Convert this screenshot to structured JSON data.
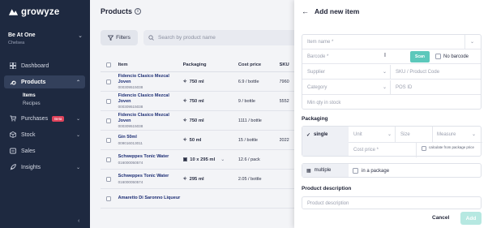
{
  "brand": {
    "name": "growyze"
  },
  "store": {
    "name": "Be At One",
    "subtitle": "Chelsea"
  },
  "nav": {
    "dashboard": "Dashboard",
    "products": "Products",
    "items": "Items",
    "recipes": "Recipes",
    "purchases": "Purchases",
    "purchases_badge": "Beta",
    "stock": "Stock",
    "sales": "Sales",
    "insights": "Insights"
  },
  "main": {
    "title": "Products",
    "filters_label": "Filters",
    "search_placeholder": "Search by product name",
    "columns": {
      "item": "Item",
      "packaging": "Packaging",
      "cost": "Cost price",
      "sku": "SKU"
    },
    "rows": [
      {
        "name": "Fidencio Clasico Mezcal Joven",
        "code": "000309515038",
        "packaging": "750 ml",
        "cost": "6.9 / bottle",
        "sku": "7960",
        "checked": false
      },
      {
        "name": "Fidencio Clasico Mezcal Joven",
        "code": "000309515038",
        "packaging": "750 ml",
        "cost": "9 / bottle",
        "sku": "5552",
        "checked": false
      },
      {
        "name": "Fidencio Clasico Mezcal Joven",
        "code": "000309515038",
        "packaging": "750 ml",
        "cost": "1111 / bottle",
        "sku": "",
        "checked": false
      },
      {
        "name": "Gin 50ml",
        "code": "009016013011",
        "packaging": "50 ml",
        "cost": "15 / bottle",
        "sku": "2022",
        "checked": false
      },
      {
        "name": "Schweppes Tonic Water",
        "code": "016000050574",
        "packaging": "10 x 295 ml",
        "cost": "12.6 / pack",
        "sku": "",
        "checked": true
      },
      {
        "name": "Schweppes Tonic Water",
        "code": "016000050574",
        "packaging": "295 ml",
        "cost": "2.05 / bottle",
        "sku": "",
        "checked": false
      },
      {
        "name": "Amaretto Di Saronno Liqueur",
        "code": "",
        "packaging": "",
        "cost": "",
        "sku": "",
        "checked": false
      }
    ]
  },
  "drawer": {
    "title": "Add new item",
    "item_name_placeholder": "Item name *",
    "barcode_placeholder": "Barcode *",
    "scan_label": "Scan",
    "no_barcode_label": "No barcode",
    "supplier_placeholder": "Supplier",
    "sku_placeholder": "SKU / Product Code",
    "category_placeholder": "Category",
    "pos_placeholder": "POS ID",
    "min_qty_placeholder": "Min qty in stock",
    "packaging_label": "Packaging",
    "single_label": "single",
    "unit_placeholder": "Unit",
    "size_placeholder": "Size",
    "measure_placeholder": "Measure",
    "cost_placeholder": "Cost price *",
    "calculate_label": "calculate from package price",
    "multiple_label": "multiple",
    "in_package_label": "in a package",
    "description_label": "Product description",
    "description_placeholder": "Product description",
    "cancel_label": "Cancel",
    "add_label": "Add"
  },
  "colors": {
    "sidebar": "#1e2940",
    "accent": "#5cc8bb",
    "add_disabled": "#b6e8e1",
    "badge": "#e0435b"
  }
}
